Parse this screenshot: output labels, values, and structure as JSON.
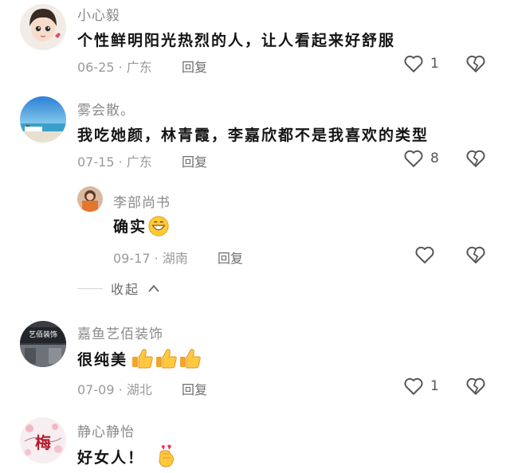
{
  "comments": [
    {
      "username": "小心毅",
      "content": "个性鲜明阳光热烈的人，让人看起来好舒服",
      "meta": "06-25 · 广东",
      "reply_label": "回复",
      "likes": "1"
    },
    {
      "username": "雾会散。",
      "content": "我吃她颜，林青霞，李嘉欣都不是我喜欢的类型",
      "meta": "07-15 · 广东",
      "reply_label": "回复",
      "likes": "8"
    },
    {
      "username": "嘉鱼艺佰装饰",
      "content": "很纯美",
      "meta": "07-09 · 湖北",
      "reply_label": "回复",
      "likes": "1",
      "avatar_text": "艺佰装饰"
    },
    {
      "username": "静心静怡",
      "content": "好女人！",
      "avatar_text": "梅"
    }
  ],
  "reply": {
    "username": "李部尚书",
    "content": "确实",
    "meta": "09-17 · 湖南",
    "reply_label": "回复"
  },
  "collapse_label": "收起",
  "icons": {
    "like": "heart-outline-icon",
    "dislike": "broken-heart-icon",
    "collapse": "chevron-up-icon",
    "emoji_grin": "grinning-face-icon",
    "emoji_thumb": "thumbs-up-icon",
    "emoji_hand": "finger-heart-icon"
  },
  "colors": {
    "username": "#8a8a8a",
    "content": "#141414",
    "meta": "#9a9a9a",
    "icon": "#555555"
  }
}
